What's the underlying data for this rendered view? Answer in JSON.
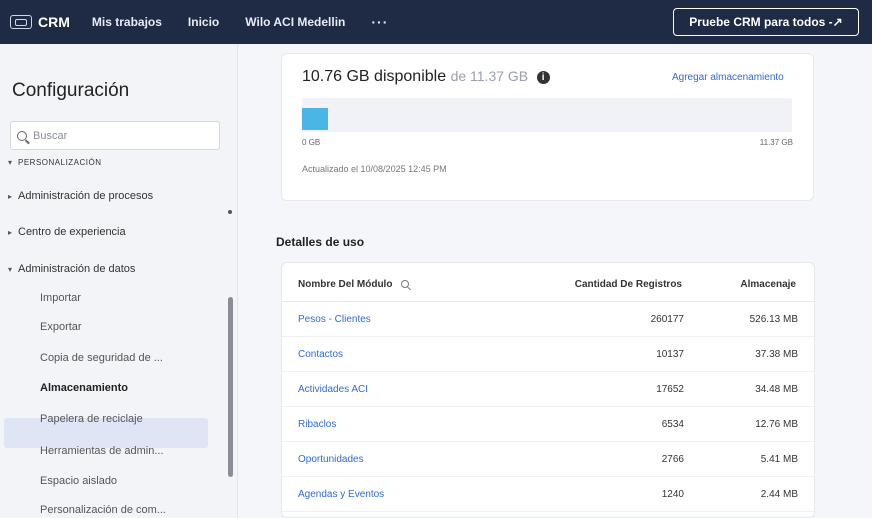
{
  "topbar": {
    "logo_text": "CRM",
    "nav": [
      "Mis trabajos",
      "Inicio",
      "Wilo ACI Medellin"
    ],
    "more": "···",
    "try_button": "Pruebe CRM para todos -↗"
  },
  "sidebar": {
    "title": "Configuración",
    "search_placeholder": "Buscar",
    "cut_item": "PERSONALIZACIÓN",
    "groups": [
      {
        "label": "Administración de procesos",
        "caret": "▸"
      },
      {
        "label": "Centro de experiencia",
        "caret": "▸"
      },
      {
        "label": "Administración de datos",
        "caret": "▾"
      }
    ],
    "sub_items": [
      "Importar",
      "Exportar",
      "Copia de seguridad de ...",
      "Almacenamiento",
      "Papelera de reciclaje",
      "Herramientas de admin...",
      "Espacio aislado",
      "Personalización de com..."
    ],
    "active_item": "Almacenamiento"
  },
  "storage": {
    "available": "10.76 GB disponible",
    "of_total": "de 11.37 GB",
    "info_icon": "i",
    "add_storage": "Agregar almacenamiento",
    "bar_min": "0 GB",
    "bar_max": "11.37 GB",
    "used_fraction": 0.054,
    "updated": "Actualizado el 10/08/2025 12:45 PM",
    "accent_color": "#4bb5e6"
  },
  "usage": {
    "title": "Detalles de uso",
    "headers": {
      "module": "Nombre Del Módulo",
      "count": "Cantidad De Registros",
      "storage": "Almacenaje"
    },
    "rows": [
      {
        "module": "Pesos - Clientes",
        "count": "260177",
        "storage": "526.13 MB"
      },
      {
        "module": "Contactos",
        "count": "10137",
        "storage": "37.38 MB"
      },
      {
        "module": "Actividades ACI",
        "count": "17652",
        "storage": "34.48 MB"
      },
      {
        "module": "Ribaclos",
        "count": "6534",
        "storage": "12.76 MB"
      },
      {
        "module": "Oportunidades",
        "count": "2766",
        "storage": "5.41 MB"
      },
      {
        "module": "Agendas y Eventos",
        "count": "1240",
        "storage": "2.44 MB"
      }
    ]
  }
}
